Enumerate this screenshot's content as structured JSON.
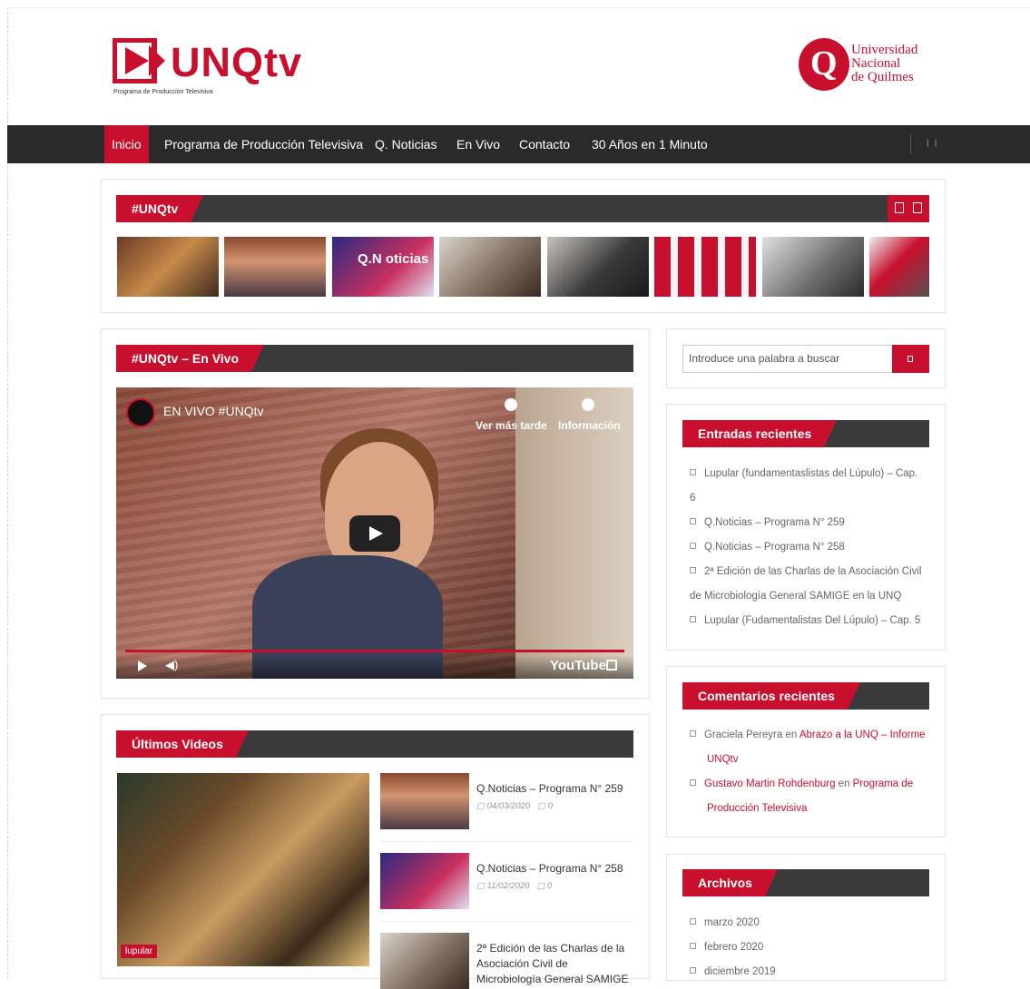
{
  "header": {
    "logo_text": "UNQtv",
    "logo_tagline": "Programa de Producción Televisiva",
    "university": [
      "Universidad",
      "Nacional",
      "de Quilmes"
    ]
  },
  "nav": {
    "items": [
      "Inicio",
      "Programa de Producción Televisiva",
      "Q. Noticias",
      "En Vivo",
      "Contacto",
      "30 Años en 1 Minuto"
    ],
    "active": "Inicio"
  },
  "carousel": {
    "title": "#UNQtv",
    "thumb_captions": [
      "",
      "",
      "Q.N oticias",
      "",
      "",
      "",
      "",
      ""
    ]
  },
  "live": {
    "title": "#UNQtv – En Vivo",
    "video_title": "EN VIVO #UNQtv",
    "watch_later": "Ver más tarde",
    "info": "Información",
    "youtube": "YouTube"
  },
  "latest": {
    "title": "Últimos Videos",
    "featured_tag": "lupular",
    "items": [
      {
        "title": "Q.Noticias – Programa N° 259",
        "date": "04/03/2020",
        "comments": "0"
      },
      {
        "title": "Q.Noticias – Programa N° 258",
        "date": "11/02/2020",
        "comments": "0"
      },
      {
        "title": "2ª Edición de las Charlas de la Asociación Civil de Microbiología General SAMIGE"
      }
    ]
  },
  "sidebar": {
    "search_placeholder": "Introduce una palabra a buscar",
    "recent_posts_title": "Entradas recientes",
    "recent_posts": [
      "Lupular (fundamentaslistas del Lúpulo) – Cap.",
      "6",
      "Q.Noticias – Programa N° 259",
      "Q.Noticias – Programa N° 258",
      "2ª Edición de las Charlas de la Asociación Civil",
      "de Microbiología General SAMIGE en la UNQ",
      "Lupular (Fudamentalistas Del Lúpulo) – Cap. 5"
    ],
    "recent_comments_title": "Comentarios recientes",
    "comments": [
      {
        "author": "Graciela Pereyra",
        "sep": "en",
        "post": "Abrazo a la UNQ – Informe",
        "post2": "UNQtv"
      },
      {
        "author": "Gustavo Martin Rohdenburg",
        "sep": "en",
        "post": "Programa de",
        "post2": "Producción Televisiva"
      }
    ],
    "archives_title": "Archivos",
    "archives": [
      "marzo 2020",
      "febrero 2020",
      "diciembre 2019"
    ]
  },
  "colors": {
    "accent": "#c8102e",
    "bar": "#3a3a3a",
    "nav": "#2a2a2a"
  }
}
